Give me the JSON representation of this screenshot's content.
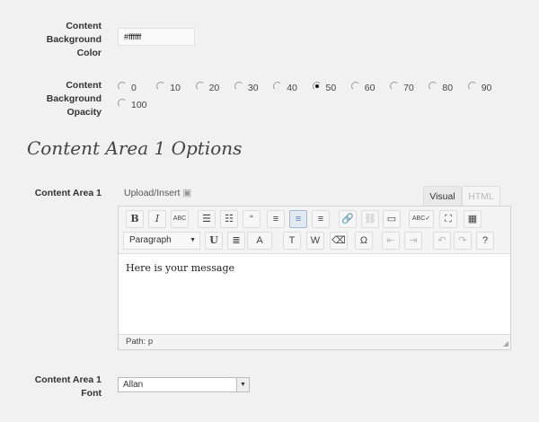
{
  "bg_color": {
    "label_lines": [
      "Content",
      "Background",
      "Color"
    ],
    "value": "#ffffff"
  },
  "opacity": {
    "label_lines": [
      "Content",
      "Background",
      "Opacity"
    ],
    "options": [
      "0",
      "10",
      "20",
      "30",
      "40",
      "50",
      "60",
      "70",
      "80",
      "90",
      "100"
    ],
    "selected": "50"
  },
  "section_title": "Content Area 1 Options",
  "area1": {
    "label": "Content Area 1",
    "upload_label": "Upload/Insert",
    "tabs": [
      "Visual",
      "HTML"
    ],
    "active_tab": "Visual",
    "toolbar_row1": [
      {
        "name": "bold",
        "g": "B"
      },
      {
        "name": "italic",
        "g": "I"
      },
      {
        "name": "strikethrough",
        "g": "ABC"
      },
      {
        "name": "bullet-list",
        "g": "☰"
      },
      {
        "name": "numbered-list",
        "g": "☷"
      },
      {
        "name": "blockquote",
        "g": "“"
      },
      {
        "name": "align-left",
        "g": "≡"
      },
      {
        "name": "align-center",
        "g": "≡"
      },
      {
        "name": "align-right",
        "g": "≡"
      },
      {
        "name": "link",
        "g": "🔗"
      },
      {
        "name": "unlink",
        "g": "⛓"
      },
      {
        "name": "more",
        "g": "▭"
      },
      {
        "name": "spellcheck",
        "g": "ABC✓"
      },
      {
        "name": "fullscreen",
        "g": "⛶"
      },
      {
        "name": "kitchen-sink",
        "g": "▦"
      }
    ],
    "format_select": "Paragraph",
    "toolbar_row2": [
      {
        "name": "underline",
        "g": "U"
      },
      {
        "name": "justify",
        "g": "≣"
      },
      {
        "name": "text-color",
        "g": "A"
      },
      {
        "name": "paste-text",
        "g": "T"
      },
      {
        "name": "paste-word",
        "g": "W"
      },
      {
        "name": "remove-format",
        "g": "⌫"
      },
      {
        "name": "special-char",
        "g": "Ω"
      },
      {
        "name": "outdent",
        "g": "⇤"
      },
      {
        "name": "indent",
        "g": "⇥"
      },
      {
        "name": "undo",
        "g": "↶"
      },
      {
        "name": "redo",
        "g": "↷"
      },
      {
        "name": "help",
        "g": "?"
      }
    ],
    "content": "Here is your message",
    "path": "Path: p"
  },
  "font": {
    "label_lines": [
      "Content Area 1",
      "Font"
    ],
    "value": "Allan"
  }
}
